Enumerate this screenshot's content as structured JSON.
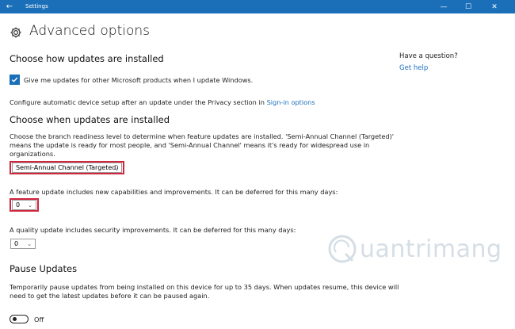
{
  "window": {
    "title": "Settings",
    "back_symbol": "←",
    "minimize_symbol": "—",
    "maximize_symbol": "☐",
    "close_symbol": "✕"
  },
  "page": {
    "title": "Advanced options"
  },
  "install_section": {
    "heading": "Choose how updates are installed",
    "checkbox_label": "Give me updates for other Microsoft products when I update Windows.",
    "checkbox_checked": true,
    "device_setup_text": "Configure automatic device setup after an update under the Privacy section in",
    "sign_in_link": "Sign-in options"
  },
  "when_section": {
    "heading": "Choose when updates are installed",
    "description_line1": "Choose the branch readiness level to determine when feature updates are installed. 'Semi-Annual Channel (Targeted)'",
    "description_line2": "means the update is ready for most people, and 'Semi-Annual Channel' means it's ready for widespread use in",
    "description_line3": "organizations.",
    "branch_select_value": "Semi-Annual Channel (Targeted)",
    "feature_text": "A feature update includes new capabilities and improvements. It can be deferred for this many days:",
    "feature_days_value": "0",
    "quality_text": "A quality update includes security improvements. It can be deferred for this many days:",
    "quality_days_value": "0"
  },
  "pause_section": {
    "heading": "Pause Updates",
    "description_line1": "Temporarily pause updates from being installed on this device for up to 35 days. When updates resume, this device will",
    "description_line2": "need to get the latest updates before it can be paused again.",
    "toggle_state": "Off"
  },
  "sidebar": {
    "question": "Have a question?",
    "help_link": "Get help"
  },
  "watermark": {
    "text": "uantrimang"
  },
  "colors": {
    "titlebar": "#1a6fb8",
    "link": "#1b6fbf",
    "highlight": "#d0263e"
  },
  "icons": {
    "settings": "gear-icon",
    "back": "back-arrow-icon",
    "checkbox": "checkmark-icon",
    "dropdown": "chevron-down-icon"
  }
}
